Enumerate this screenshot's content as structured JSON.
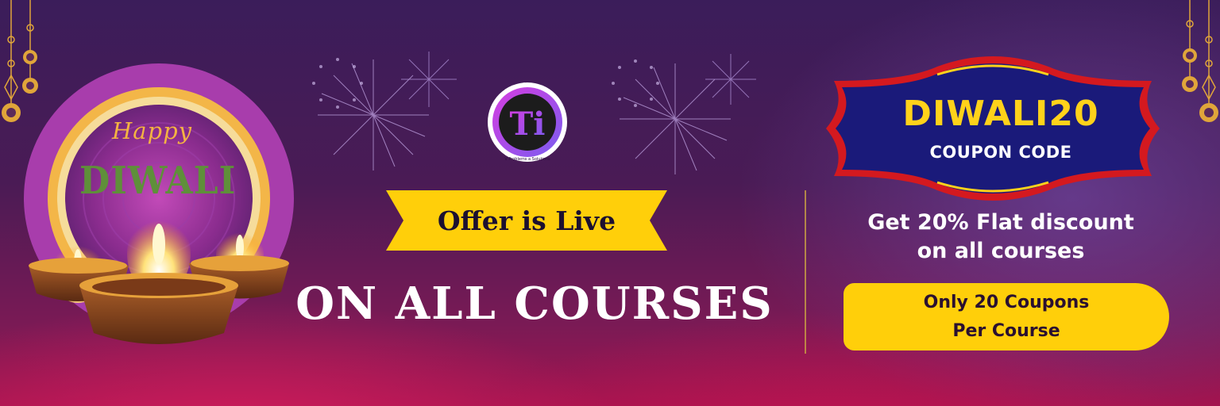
{
  "left": {
    "greeting": "Happy",
    "festival": "DIWALI"
  },
  "center": {
    "logo_text": "Ti",
    "logo_tagline": "V Problems a Solutions",
    "ribbon": "Offer is Live",
    "headline": "ON ALL COURSES"
  },
  "right": {
    "coupon_code": "DIWALI20",
    "coupon_label": "COUPON CODE",
    "discount_line1": "Get 20% Flat discount",
    "discount_line2": "on all courses",
    "pill_line1": "Only 20 Coupons",
    "pill_line2": "Per Course"
  },
  "colors": {
    "accent_yellow": "#ffd21a",
    "coupon_blue": "#1a1a7a",
    "coupon_border": "#d4191f",
    "greeting_orange": "#f4b342",
    "festival_green": "#5f8f3a"
  },
  "icons": [
    "hanging-lamp-icon",
    "firework-icon",
    "oil-lamp-icon",
    "mandala-icon",
    "infinity-icon"
  ]
}
